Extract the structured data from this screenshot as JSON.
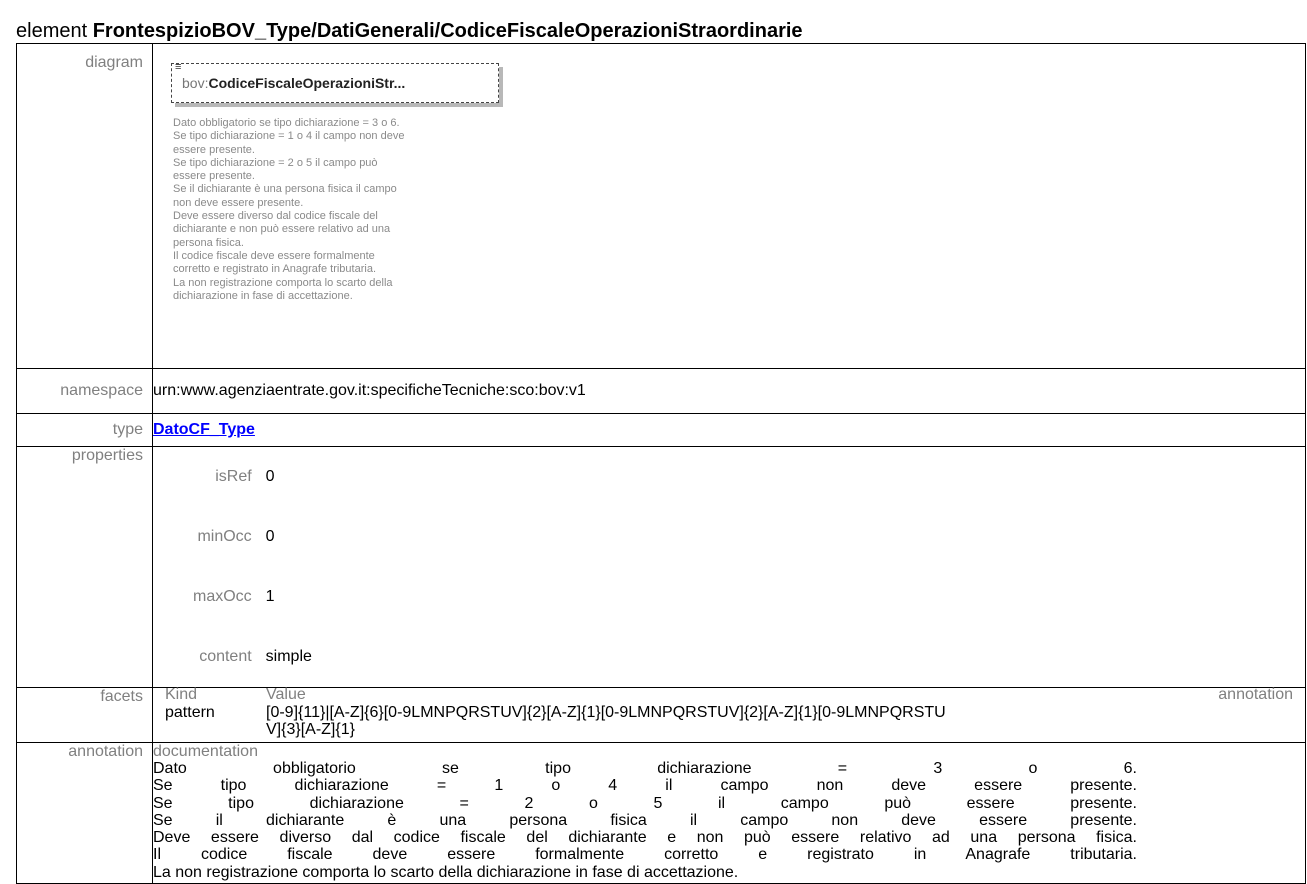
{
  "title": {
    "prefix": "element ",
    "name": "FrontespizioBOV_Type/DatiGenerali/CodiceFiscaleOperazioniStraordinarie"
  },
  "labels": {
    "diagram": "diagram",
    "namespace": "namespace",
    "type": "type",
    "properties": "properties",
    "facets": "facets",
    "annotation": "annotation"
  },
  "diagram": {
    "element_prefix": "bov:",
    "element_name": "CodiceFiscaleOperazioniStr...",
    "doc_text": "Dato obbligatorio se tipo dichiarazione = 3 o 6.\nSe tipo dichiarazione = 1 o 4 il campo non deve\nessere presente.\nSe tipo dichiarazione = 2 o 5 il campo può\nessere presente.\nSe il dichiarante è una persona fisica il campo\nnon deve essere presente.\nDeve essere diverso dal codice fiscale del\ndichiarante e non può essere relativo ad una\npersona fisica.\nIl codice fiscale deve essere formalmente\ncorretto e registrato in Anagrafe tributaria.\nLa non registrazione comporta lo scarto della\ndichiarazione in fase di accettazione."
  },
  "namespace": "urn:www.agenziaentrate.gov.it:specificheTecniche:sco:bov:v1",
  "type": "DatoCF_Type",
  "properties": [
    {
      "key": "isRef",
      "value": "0"
    },
    {
      "key": "minOcc",
      "value": "0"
    },
    {
      "key": "maxOcc",
      "value": "1"
    },
    {
      "key": "content",
      "value": "simple"
    }
  ],
  "facets": {
    "headers": {
      "kind": "Kind",
      "value": "Value",
      "annotation": "annotation"
    },
    "kind": "pattern",
    "value": "[0-9]{11}|[A-Z]{6}[0-9LMNPQRSTUV]{2}[A-Z]{1}[0-9LMNPQRSTUV]{2}[A-Z]{1}[0-9LMNPQRSTUV]{3}[A-Z]{1}"
  },
  "annotation": {
    "label": "documentation",
    "lines": [
      "Dato obbligatorio se tipo dichiarazione = 3 o 6.",
      "Se tipo dichiarazione = 1 o 4 il campo non deve essere presente.",
      "Se tipo dichiarazione = 2 o 5 il campo può essere presente.",
      "Se il dichiarante è una persona fisica il campo non deve essere presente.",
      "Deve essere diverso dal codice fiscale del dichiarante e non può essere relativo ad una persona fisica.",
      "Il codice fiscale deve essere formalmente corretto e registrato in Anagrafe tributaria.",
      "La non registrazione comporta lo scarto della dichiarazione in fase di accettazione."
    ]
  }
}
